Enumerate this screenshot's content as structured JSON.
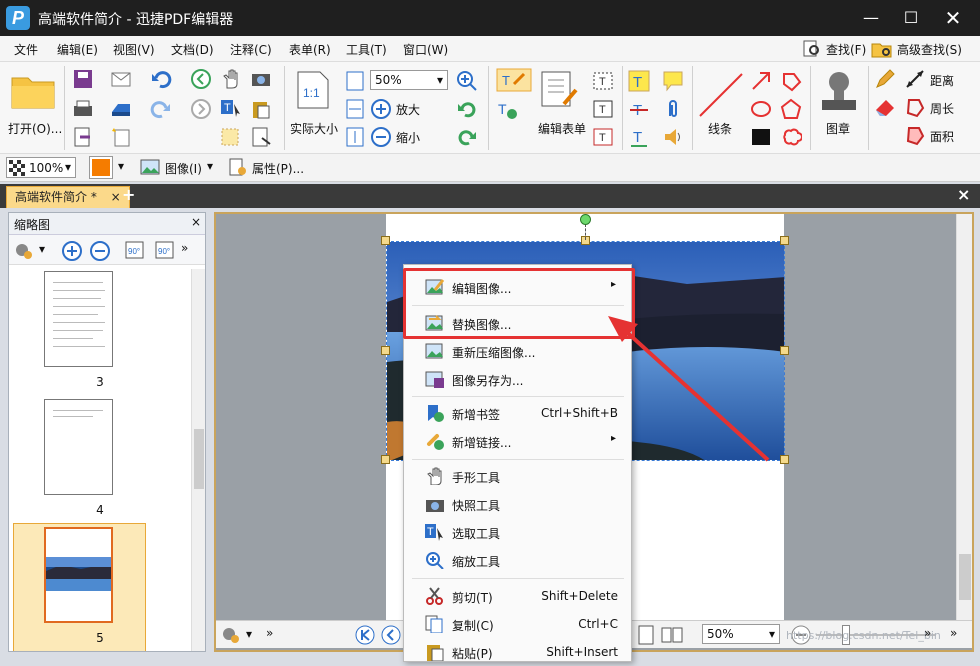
{
  "window": {
    "title": "高端软件简介 - 迅捷PDF编辑器",
    "app_logo": "P"
  },
  "menu": {
    "items": [
      "文件",
      "编辑(E)",
      "视图(V)",
      "文档(D)",
      "注释(C)",
      "表单(R)",
      "工具(T)",
      "窗口(W)"
    ],
    "find": "查找(F)",
    "advanced_find": "高级查找(S)"
  },
  "toolbar": {
    "open": "打开(O)...",
    "zoom_value": "50%",
    "actual_size": "实际大小",
    "actual_size_icon": "1:1",
    "zoom_in": "放大",
    "zoom_out": "缩小",
    "edit_form": "编辑表单",
    "line": "线条",
    "stamp": "图章",
    "distance": "距离",
    "perimeter": "周长",
    "area": "面积"
  },
  "toolbar2": {
    "zoom": "100%",
    "image": "图像(I)",
    "properties": "属性(P)..."
  },
  "tab": {
    "name": "高端软件简介 *",
    "add": "+",
    "close": "×"
  },
  "sidebar": {
    "title": "缩略图",
    "close": "×",
    "rot_left": "90°",
    "rot_right": "90°",
    "pages": [
      "3",
      "4",
      "5"
    ]
  },
  "context_menu": {
    "items": [
      {
        "label": "编辑图像...",
        "shortcut": "",
        "submenu": true
      },
      {
        "label": "替换图像...",
        "shortcut": "",
        "submenu": false
      },
      {
        "label": "重新压缩图像...",
        "shortcut": "",
        "submenu": false
      },
      {
        "label": "图像另存为...",
        "shortcut": "",
        "submenu": false
      },
      {
        "label": "新增书签",
        "shortcut": "Ctrl+Shift+B",
        "submenu": false
      },
      {
        "label": "新增链接...",
        "shortcut": "",
        "submenu": true
      },
      {
        "label": "手形工具",
        "shortcut": "",
        "submenu": false
      },
      {
        "label": "快照工具",
        "shortcut": "",
        "submenu": false
      },
      {
        "label": "选取工具",
        "shortcut": "",
        "submenu": false
      },
      {
        "label": "缩放工具",
        "shortcut": "",
        "submenu": false
      },
      {
        "label": "剪切(T)",
        "shortcut": "Shift+Delete",
        "submenu": false
      },
      {
        "label": "复制(C)",
        "shortcut": "Ctrl+C",
        "submenu": false
      },
      {
        "label": "粘贴(P)",
        "shortcut": "Shift+Insert",
        "submenu": false
      }
    ]
  },
  "status": {
    "zoom": "50%",
    "watermark": "https://blog.csdn.net/Tel_bin"
  },
  "colors": {
    "titlebar": "#1f1f1f",
    "accent": "#e53232",
    "tab": "#fbd98a"
  }
}
